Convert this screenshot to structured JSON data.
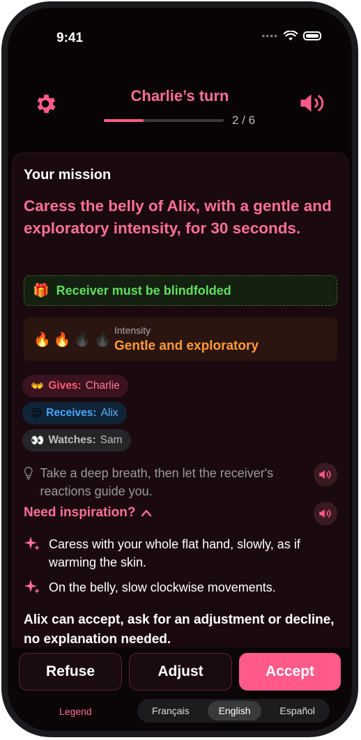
{
  "status_bar": {
    "time": "9:41"
  },
  "header": {
    "title": "Charlie’s turn",
    "progress_text": "2 / 6",
    "progress_fraction": 0.333
  },
  "mission": {
    "label": "Your mission",
    "text": "Caress the belly of Alix, with a gentle and exploratory intensity, for 30 seconds.",
    "blindfold_text": "Receiver must be blindfolded",
    "intensity_label": "Intensity",
    "intensity_value": "Gentle and exploratory",
    "intensity_level": 2,
    "intensity_max": 4
  },
  "roles": [
    {
      "emoji": "👐",
      "key": "Gives:",
      "value": "Charlie",
      "kind": "gives"
    },
    {
      "emoji": "😌",
      "key": "Receives:",
      "value": "Alix",
      "kind": "receives"
    },
    {
      "emoji": "👀",
      "key": "Watches:",
      "value": "Sam",
      "kind": "watches"
    }
  ],
  "tip": {
    "text": "Take a deep breath, then let the receiver's reactions guide you."
  },
  "inspiration": {
    "title": "Need inspiration?",
    "items": [
      "Caress with your whole flat hand, slowly, as if warming the skin.",
      "On the belly, slow clockwise movements."
    ]
  },
  "consent_text": "Alix can accept, ask for an adjustment or decline, no explanation needed.",
  "actions": {
    "refuse": "Refuse",
    "adjust": "Adjust",
    "accept": "Accept"
  },
  "footer": {
    "legend": "Legend",
    "languages": [
      "Français",
      "English",
      "Español"
    ],
    "active_language": "English"
  },
  "colors": {
    "accent": "#ff5a8a",
    "green": "#5fe05f",
    "orange": "#ff9a3a"
  }
}
